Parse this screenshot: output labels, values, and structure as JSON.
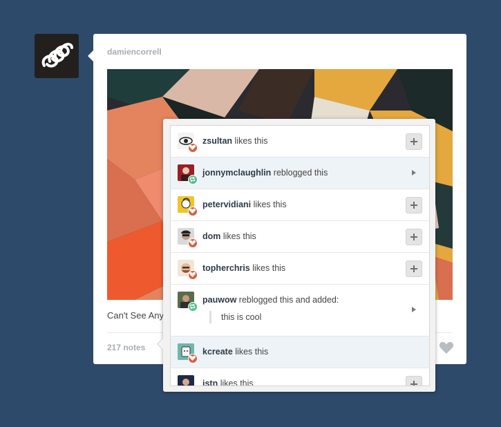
{
  "post": {
    "author": "damiencorrell",
    "caption": "Can't See Anything",
    "notes_label": "217 notes",
    "icons": {
      "blog_avatar": "spiral-logo-icon",
      "like": "heart-icon"
    }
  },
  "notes": [
    {
      "user": "zsultan",
      "action": "likes this",
      "type": "like",
      "control": "follow"
    },
    {
      "user": "jonnymclaughlin",
      "action": "reblogged this",
      "type": "reblog",
      "control": "arrow"
    },
    {
      "user": "petervidiani",
      "action": "likes this",
      "type": "like",
      "control": "follow"
    },
    {
      "user": "dom",
      "action": "likes this",
      "type": "like",
      "control": "follow"
    },
    {
      "user": "topherchris",
      "action": "likes this",
      "type": "like",
      "control": "follow"
    },
    {
      "user": "pauwow",
      "action": "reblogged this and added:",
      "type": "reblog",
      "comment": "this is cool",
      "control": "arrow"
    },
    {
      "user": "kcreate",
      "action": "likes this",
      "type": "like",
      "control": "none"
    },
    {
      "user": "jstn",
      "action": "likes this",
      "type": "like",
      "control": "follow"
    }
  ],
  "colors": {
    "background": "#2e4a6b",
    "like_badge": "#d95e40",
    "reblog_badge": "#56bc8a",
    "username": "#2f3b48"
  }
}
